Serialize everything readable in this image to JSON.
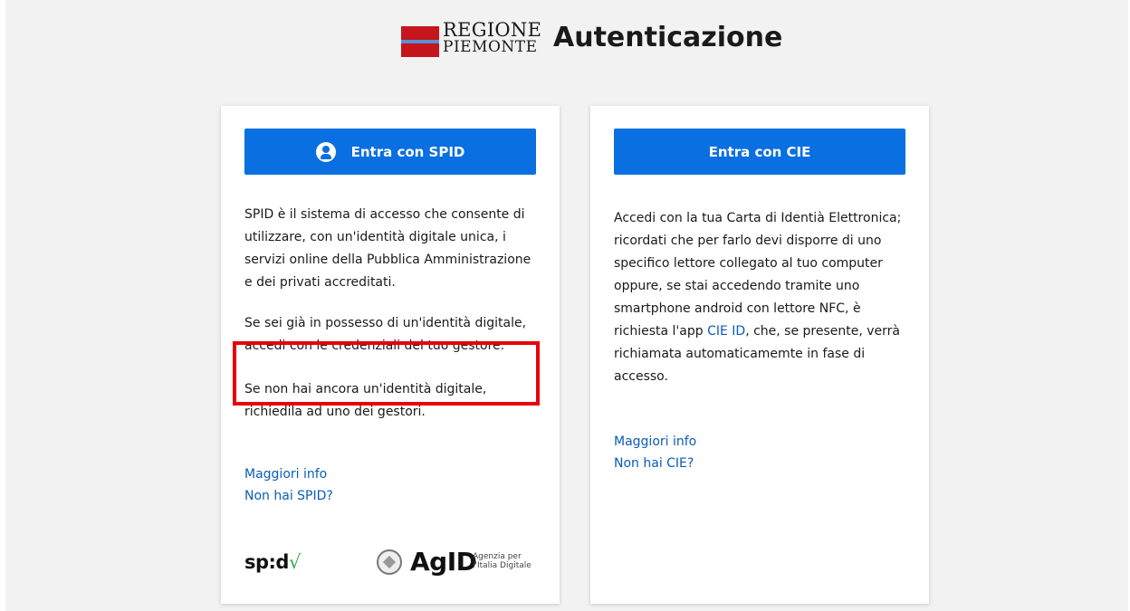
{
  "header": {
    "logo_line1": "REGIONE",
    "logo_line2": "PIEMONTE",
    "title": "Autenticazione"
  },
  "spid_card": {
    "button_label": "Entra con SPID",
    "paragraph1": "SPID è il sistema di accesso che consente di utilizzare, con un'identità digitale unica, i servizi online della Pubblica Amministrazione e dei privati accreditati.",
    "paragraph2": "Se sei già in possesso di un'identità digitale, accedi con le credenziali del tuo gestore.",
    "paragraph3": "Se non hai ancora un'identità digitale, richiedila ad uno dei gestori.",
    "link_more_info": "Maggiori info",
    "link_no_spid": "Non hai SPID?",
    "spid_logo_text": "sp:d",
    "spid_logo_check": "√",
    "agid_logo_text": "AgID",
    "agid_tagline1": "Agenzia per",
    "agid_tagline2": "l'Italia Digitale"
  },
  "cie_card": {
    "button_label": "Entra con CIE",
    "paragraph_before_link": "Accedi con la tua Carta di Identià Elettronica; ricordati che per farlo devi disporre di uno specifico lettore collegato al tuo computer oppure, se stai accedendo tramite uno smartphone android con lettore NFC, è richiesta l'app ",
    "inline_link": "CIE ID",
    "paragraph_after_link": ", che, se presente, verrà richiamata automaticamemte in fase di accesso.",
    "link_more_info": "Maggiori info",
    "link_no_cie": "Non hai CIE?"
  },
  "colors": {
    "primary_button": "#0a6fe0",
    "link": "#0a5cb8",
    "highlight_box": "#e8000b",
    "background": "#f2f2f2"
  },
  "icons": [
    "user-circle-icon",
    "region-flag-icon",
    "agid-emblem-icon",
    "spid-check-icon"
  ]
}
